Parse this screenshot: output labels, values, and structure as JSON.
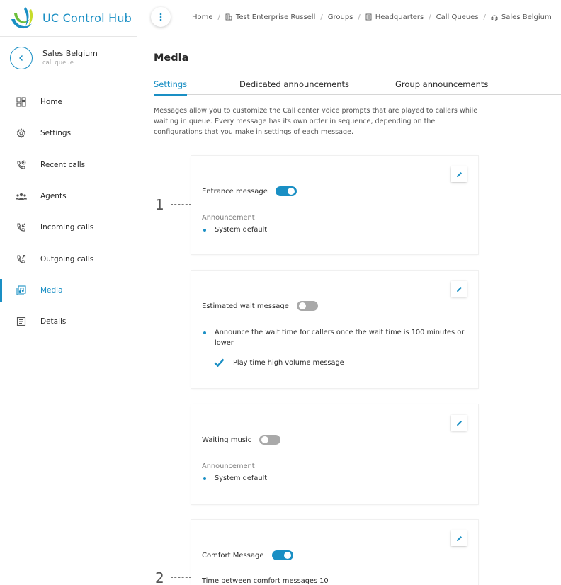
{
  "app": {
    "title": "UC Control Hub"
  },
  "context": {
    "title": "Sales Belgium",
    "subtitle": "call queue"
  },
  "sidebar": {
    "items": [
      {
        "label": "Home",
        "icon": "dashboard-grid-icon"
      },
      {
        "label": "Settings",
        "icon": "gear-icon"
      },
      {
        "label": "Recent calls",
        "icon": "phone-clock-icon"
      },
      {
        "label": "Agents",
        "icon": "group-icon"
      },
      {
        "label": "Incoming calls",
        "icon": "incoming-call-icon"
      },
      {
        "label": "Outgoing calls",
        "icon": "outgoing-call-icon"
      },
      {
        "label": "Media",
        "icon": "media-icon",
        "active": true
      },
      {
        "label": "Details",
        "icon": "details-list-icon"
      }
    ]
  },
  "breadcrumb": [
    "Home",
    "Test Enterprise Russell",
    "Groups",
    "Headquarters",
    "Call Queues",
    "Sales Belgium"
  ],
  "page": {
    "title": "Media",
    "tabs": [
      "Settings",
      "Dedicated announcements",
      "Group announcements"
    ],
    "active_tab": "Settings",
    "description": "Messages allow you to customize the Call center voice prompts that are played to callers while waiting in queue. Every message has its own order in sequence, depending on the configurations that you make in settings of each message."
  },
  "sequence": {
    "steps": [
      "1",
      "2"
    ]
  },
  "cards": {
    "entrance": {
      "label": "Entrance message",
      "enabled": true,
      "sub_label": "Announcement",
      "value": "System default"
    },
    "estimated_wait": {
      "label": "Estimated wait message",
      "enabled": false,
      "bullet": "Announce the wait time for callers once the wait time is 100 minutes or lower",
      "check": "Play time high volume message"
    },
    "waiting_music": {
      "label": "Waiting music",
      "enabled": false,
      "sub_label": "Announcement",
      "value": "System default"
    },
    "comfort": {
      "label": "Comfort Message",
      "enabled": true,
      "sub_label": "Time between comfort messages 10"
    }
  },
  "colors": {
    "accent": "#1a8fc4",
    "toggle_off": "#a9a9a9"
  }
}
